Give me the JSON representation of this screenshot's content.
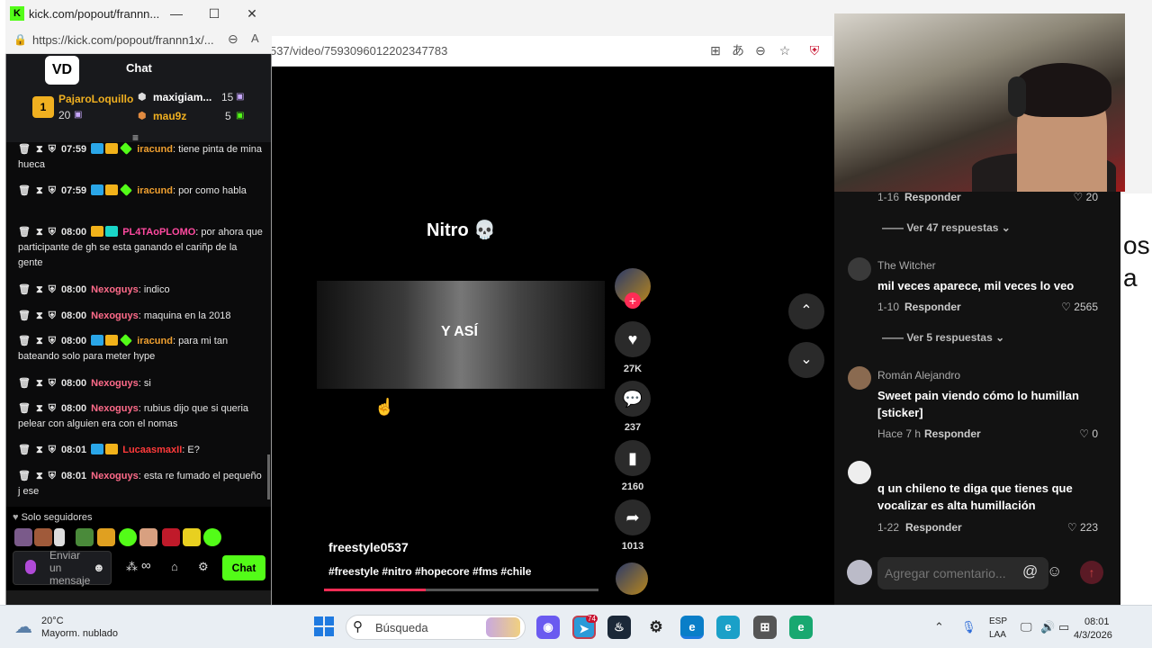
{
  "kick": {
    "window_title": "kick.com/popout/frannn...",
    "url": "https://kick.com/popout/frannn1x/...",
    "header_title": "Chat",
    "logo": "VD",
    "top_gifters": [
      {
        "rank": "1",
        "name": "PajaroLoquillo",
        "amount": "20"
      },
      {
        "name": "maxigiam...",
        "amount": "15"
      },
      {
        "name": "mau9z",
        "amount": "5"
      }
    ],
    "messages": [
      {
        "time": "07:59",
        "user": "iracund",
        "text": ": tiene pinta de mina hueca",
        "color": "#f0a030"
      },
      {
        "time": "07:59",
        "user": "iracund",
        "text": ": por como habla",
        "color": "#f0a030"
      },
      {
        "time": "08:00",
        "user": "PL4TAoPLOMO",
        "text": ": por ahora que participante de gh se esta ganando el cariñp de la gente",
        "color": "#ff4aa0"
      },
      {
        "time": "08:00",
        "user": "Nexoguys",
        "text": ": indico",
        "color": "#ff6b8a"
      },
      {
        "time": "08:00",
        "user": "Nexoguys",
        "text": ": maquina en la 2018",
        "color": "#ff6b8a"
      },
      {
        "time": "08:00",
        "user": "iracund",
        "text": ": para mi tan bateando solo para meter hype",
        "color": "#f0a030"
      },
      {
        "time": "08:00",
        "user": "Nexoguys",
        "text": ": si",
        "color": "#ff6b8a"
      },
      {
        "time": "08:00",
        "user": "Nexoguys",
        "text": ": rubius dijo que si queria pelear con alguien era con el nomas",
        "color": "#ff6b8a"
      },
      {
        "time": "08:01",
        "user": "LucaasmaxII",
        "text": ": E?",
        "color": "#ff3a3a"
      },
      {
        "time": "08:01",
        "user": "Nexoguys",
        "text": ": esta re fumado el pequeño j ese",
        "color": "#ff6b8a"
      }
    ],
    "followers_only": "Solo seguidores",
    "input_placeholder": "Enviar un mensaje",
    "chat_button": "Chat",
    "infinity": "∞"
  },
  "browser": {
    "url_tail": "537/video/7593096012202347783"
  },
  "tiktok": {
    "title": "Nitro 💀",
    "caption": "Y ASÍ",
    "author": "freestyle0537",
    "hashtags": "#freestyle #nitro #hopecore #fms #chile",
    "likes": "27K",
    "comments": "237",
    "saves": "2160",
    "shares": "1013",
    "progress_fraction": 0.37
  },
  "comments": {
    "top_meta": {
      "date": "1-16",
      "reply": "Responder",
      "likes": "20"
    },
    "view_replies_1": "Ver 47 respuestas",
    "items": [
      {
        "name": "The Witcher",
        "text": "mil veces aparece, mil veces lo veo",
        "date": "1-10",
        "reply": "Responder",
        "likes": "2565"
      },
      {
        "name": "Román Alejandro",
        "text": "Sweet pain viendo cómo lo humillan [sticker]",
        "date": "Hace 7 h",
        "reply": "Responder",
        "likes": "0"
      },
      {
        "name": "",
        "text": "q un chileno te diga que tienes que vocalizar es alta humillación",
        "date": "1-22",
        "reply": "Responder",
        "likes": "223"
      }
    ],
    "view_replies_2": "Ver 5 respuestas",
    "input_placeholder": "Agregar comentario..."
  },
  "right_edge_text": "os\na",
  "taskbar": {
    "temp": "20°C",
    "weather": "Mayorm. nublado",
    "search_placeholder": "Búsqueda",
    "lang1": "ESP",
    "lang2": "LAA",
    "time": "08:01",
    "date": "4/3/2026",
    "badge_count": "74"
  },
  "colors": {
    "kick_green": "#53fc18",
    "tiktok_red": "#fe2c55",
    "accent_blue": "#1f7ae0"
  }
}
